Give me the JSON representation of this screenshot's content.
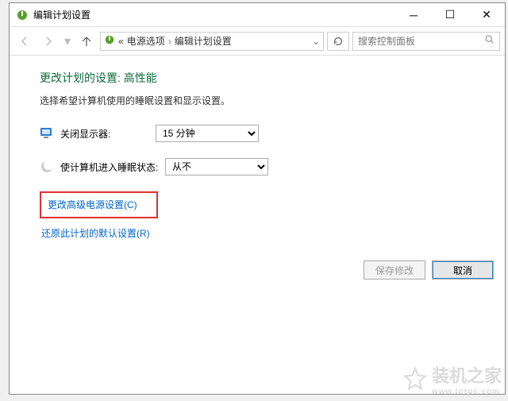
{
  "window": {
    "title": "编辑计划设置"
  },
  "nav": {
    "breadcrumb": {
      "item1": "电源选项",
      "item2": "编辑计划设置",
      "prefix": "«"
    },
    "search_placeholder": "搜索控制面板"
  },
  "page": {
    "heading": "更改计划的设置: 高性能",
    "subheading": "选择希望计算机使用的睡眠设置和显示设置。",
    "row_display": {
      "label": "关闭显示器:",
      "value": "15 分钟"
    },
    "row_sleep": {
      "label": "使计算机进入睡眠状态:",
      "value": "从不"
    },
    "link_advanced": "更改高级电源设置(C)",
    "link_restore": "还原此计划的默认设置(R)",
    "btn_save": "保存修改",
    "btn_cancel": "取消"
  },
  "watermark": {
    "text": "装机之家",
    "sub": "www.lotpc.com"
  }
}
